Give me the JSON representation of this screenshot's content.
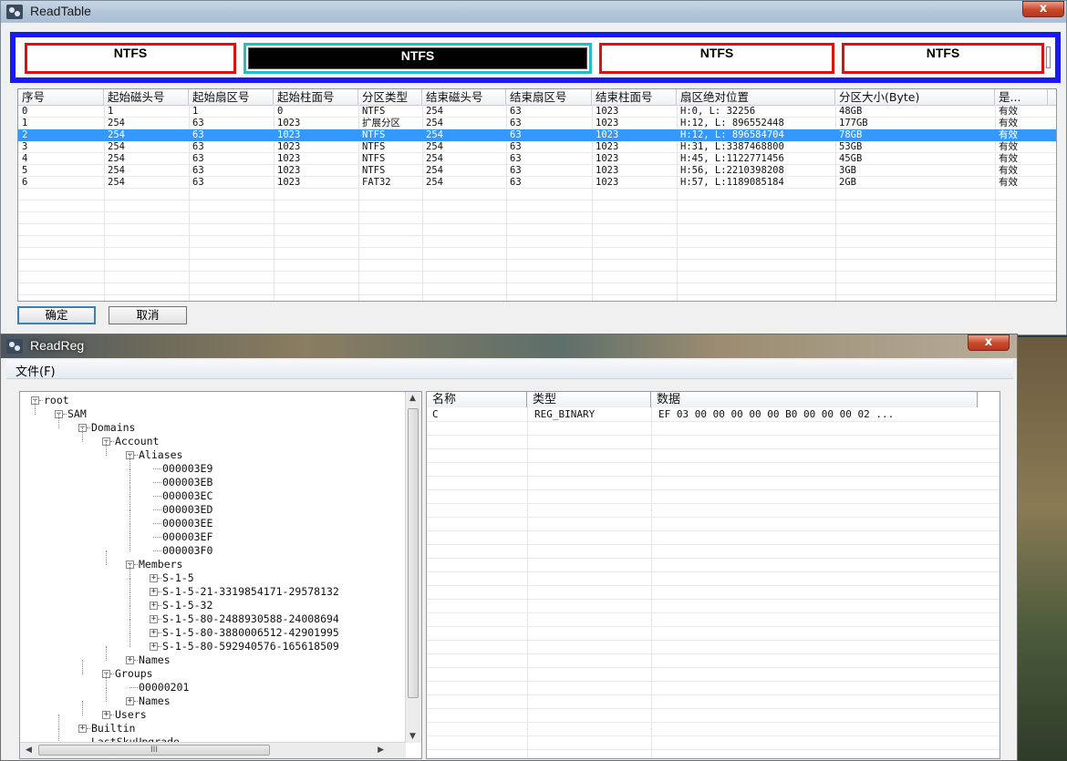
{
  "readtable": {
    "title": "ReadTable",
    "close_glyph": "x",
    "partitions": [
      "NTFS",
      "NTFS",
      "NTFS",
      "NTFS"
    ],
    "columns": [
      "序号",
      "起始磁头号",
      "起始扇区号",
      "起始柱面号",
      "分区类型",
      "结束磁头号",
      "结束扇区号",
      "结束柱面号",
      "扇区绝对位置",
      "分区大小(Byte)",
      "是..."
    ],
    "rows": [
      [
        "0",
        "1",
        "1",
        "0",
        "NTFS",
        "254",
        "63",
        "1023",
        "H:0, L:        32256",
        "48GB",
        "有效"
      ],
      [
        "1",
        "254",
        "63",
        "1023",
        "扩展分区",
        "254",
        "63",
        "1023",
        "H:12, L:  896552448",
        "177GB",
        "有效"
      ],
      [
        "2",
        "254",
        "63",
        "1023",
        "NTFS",
        "254",
        "63",
        "1023",
        "H:12, L:  896584704",
        "78GB",
        "有效"
      ],
      [
        "3",
        "254",
        "63",
        "1023",
        "NTFS",
        "254",
        "63",
        "1023",
        "H:31, L:3387468800",
        "53GB",
        "有效"
      ],
      [
        "4",
        "254",
        "63",
        "1023",
        "NTFS",
        "254",
        "63",
        "1023",
        "H:45, L:1122771456",
        "45GB",
        "有效"
      ],
      [
        "5",
        "254",
        "63",
        "1023",
        "NTFS",
        "254",
        "63",
        "1023",
        "H:56, L:2210398208",
        "3GB",
        "有效"
      ],
      [
        "6",
        "254",
        "63",
        "1023",
        "FAT32",
        "254",
        "63",
        "1023",
        "H:57, L:1189085184",
        "2GB",
        "有效"
      ]
    ],
    "selected_row": 2,
    "ok_label": "确定",
    "cancel_label": "取消"
  },
  "readreg": {
    "title": "ReadReg",
    "close_glyph": "x",
    "menu_file": "文件(F)",
    "tree": [
      {
        "label": "root",
        "depth": 0,
        "state": "expanded"
      },
      {
        "label": "SAM",
        "depth": 1,
        "state": "expanded"
      },
      {
        "label": "Domains",
        "depth": 2,
        "state": "expanded"
      },
      {
        "label": "Account",
        "depth": 3,
        "state": "expanded"
      },
      {
        "label": "Aliases",
        "depth": 4,
        "state": "expanded"
      },
      {
        "label": "000003E9",
        "depth": 5,
        "state": "leaf"
      },
      {
        "label": "000003EB",
        "depth": 5,
        "state": "leaf"
      },
      {
        "label": "000003EC",
        "depth": 5,
        "state": "leaf"
      },
      {
        "label": "000003ED",
        "depth": 5,
        "state": "leaf"
      },
      {
        "label": "000003EE",
        "depth": 5,
        "state": "leaf"
      },
      {
        "label": "000003EF",
        "depth": 5,
        "state": "leaf"
      },
      {
        "label": "000003F0",
        "depth": 5,
        "state": "leaf"
      },
      {
        "label": "Members",
        "depth": 4,
        "state": "expanded"
      },
      {
        "label": "S-1-5",
        "depth": 5,
        "state": "collapsed"
      },
      {
        "label": "S-1-5-21-3319854171-29578132",
        "depth": 5,
        "state": "collapsed"
      },
      {
        "label": "S-1-5-32",
        "depth": 5,
        "state": "collapsed"
      },
      {
        "label": "S-1-5-80-2488930588-24008694",
        "depth": 5,
        "state": "collapsed"
      },
      {
        "label": "S-1-5-80-3880006512-42901995",
        "depth": 5,
        "state": "collapsed"
      },
      {
        "label": "S-1-5-80-592940576-165618509",
        "depth": 5,
        "state": "collapsed"
      },
      {
        "label": "Names",
        "depth": 4,
        "state": "collapsed"
      },
      {
        "label": "Groups",
        "depth": 3,
        "state": "expanded"
      },
      {
        "label": "00000201",
        "depth": 4,
        "state": "leaf"
      },
      {
        "label": "Names",
        "depth": 4,
        "state": "collapsed"
      },
      {
        "label": "Users",
        "depth": 3,
        "state": "collapsed"
      },
      {
        "label": "Builtin",
        "depth": 2,
        "state": "collapsed"
      },
      {
        "label": "LastSkuUpgrade",
        "depth": 2,
        "state": "leaf"
      }
    ],
    "list_columns": [
      "名称",
      "类型",
      "数据"
    ],
    "list_rows": [
      [
        "C",
        "REG_BINARY",
        "EF 03 00 00 00 00 00 B0 00 00 00 02 ..."
      ]
    ],
    "hscroll_thumb": "III"
  }
}
